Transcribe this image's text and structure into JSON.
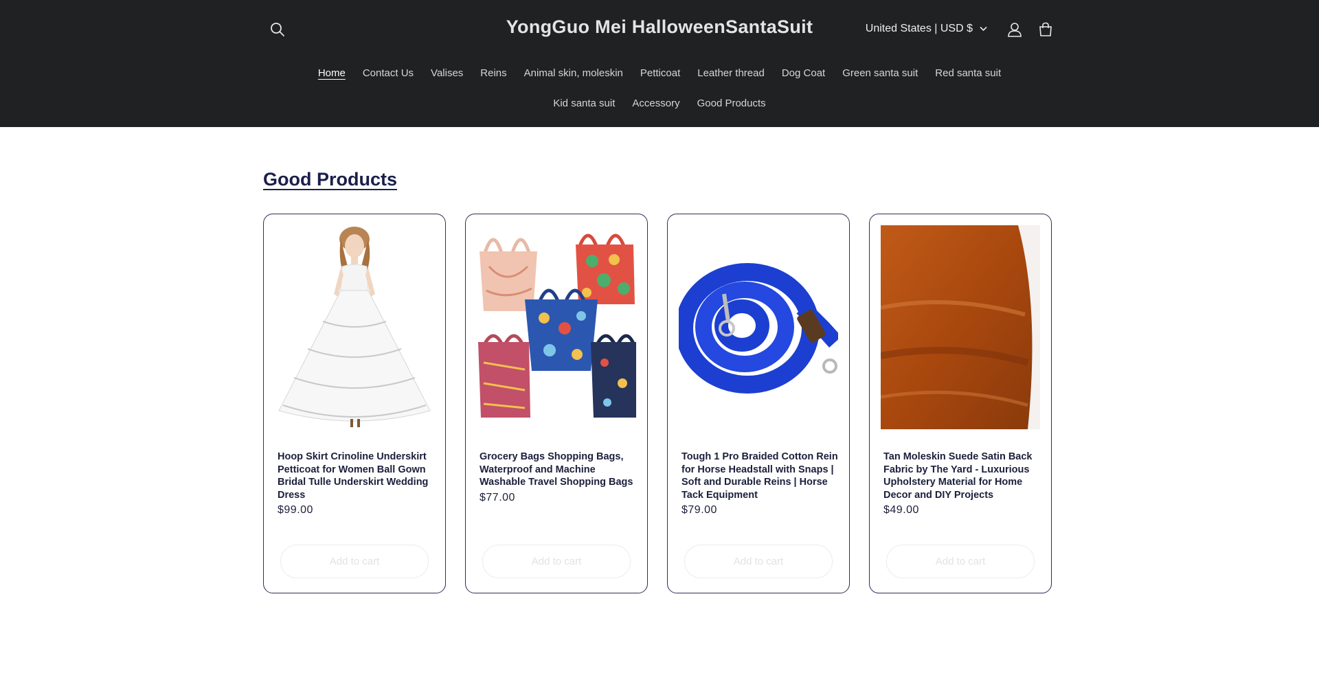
{
  "header": {
    "brand": "YongGuo Mei HalloweenSantaSuit",
    "locale": "United States | USD $"
  },
  "nav": {
    "row1": [
      "Home",
      "Contact Us",
      "Valises",
      "Reins",
      "Animal skin, moleskin",
      "Petticoat",
      "Leather thread",
      "Dog Coat",
      "Green santa suit",
      "Red santa suit"
    ],
    "row2": [
      "Kid santa suit",
      "Accessory",
      "Good Products"
    ]
  },
  "section": {
    "title": "Good Products"
  },
  "products": [
    {
      "title": "Hoop Skirt Crinoline Underskirt Petticoat for Women Ball Gown Bridal Tulle Underskirt Wedding Dress",
      "price": "$99.00",
      "button": "Add to cart"
    },
    {
      "title": "Grocery Bags Shopping Bags, Waterproof and Machine Washable Travel Shopping Bags",
      "price": "$77.00",
      "button": "Add to cart"
    },
    {
      "title": "Tough 1 Pro Braided Cotton Rein for Horse Headstall with Snaps | Soft and Durable Reins | Horse Tack Equipment",
      "price": "$79.00",
      "button": "Add to cart"
    },
    {
      "title": "Tan Moleskin Suede Satin Back Fabric by The Yard - Luxurious Upholstery Material for Home Decor and DIY Projects",
      "price": "$49.00",
      "button": "Add to cart"
    }
  ],
  "colors": {
    "header_bg": "#202123",
    "accent": "#1a1f4a"
  }
}
